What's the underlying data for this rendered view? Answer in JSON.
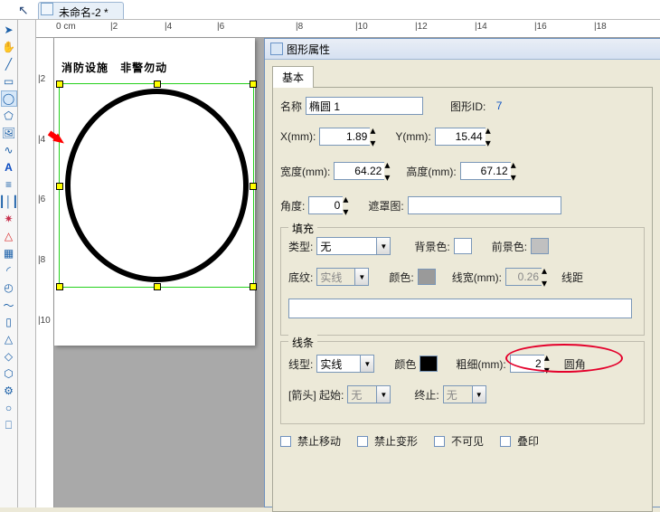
{
  "window": {
    "tab_title": "未命名-2 *"
  },
  "ruler": {
    "h_labels": [
      "0 cm",
      "|2",
      "|4",
      "|6",
      "|8",
      "|10",
      "|12",
      "|14",
      "|16",
      "|18"
    ],
    "v_labels": [
      "|2",
      "|4",
      "|6",
      "|8",
      "|10"
    ]
  },
  "canvas": {
    "heading_a": "消防设施",
    "heading_b": "非警勿动"
  },
  "panel": {
    "title": "图形属性",
    "tab_basic": "基本",
    "name_label": "名称",
    "name_value": "椭圆 1",
    "id_label": "图形ID:",
    "id_value": "7",
    "x_label": "X(mm):",
    "x_value": "1.89",
    "y_label": "Y(mm):",
    "y_value": "15.44",
    "w_label": "宽度(mm):",
    "w_value": "64.22",
    "h_label": "高度(mm):",
    "h_value": "67.12",
    "angle_label": "角度:",
    "angle_value": "0",
    "mask_label": "遮罩图:",
    "fill": {
      "legend": "填充",
      "type_label": "类型:",
      "type_value": "无",
      "bgcolor_label": "背景色:",
      "fgcolor_label": "前景色:",
      "pattern_label": "底纹:",
      "pattern_value": "实线",
      "color_label": "颜色:",
      "linewidth_label": "线宽(mm):",
      "linewidth_value": "0.26",
      "spacing_label": "线距"
    },
    "line": {
      "legend": "线条",
      "type_label": "线型:",
      "type_value": "实线",
      "color_label": "颜色",
      "thickness_label": "粗细(mm):",
      "thickness_value": "2",
      "radius_label": "圆角",
      "arrow_label": "[箭头] 起始:",
      "arrow_start": "无",
      "arrow_end_label": "终止:",
      "arrow_end": "无"
    },
    "checks": {
      "lockmove": "禁止移动",
      "lockresize": "禁止变形",
      "invisible": "不可见",
      "overprint": "叠印"
    }
  }
}
